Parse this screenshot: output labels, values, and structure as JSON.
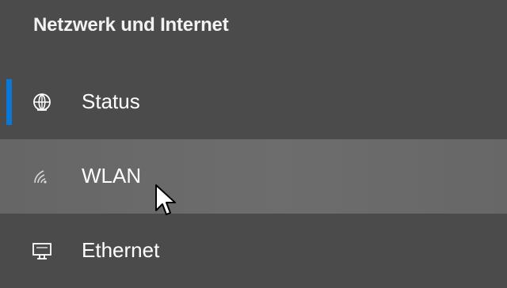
{
  "panel": {
    "title": "Netzwerk und Internet"
  },
  "nav": {
    "items": [
      {
        "id": "status",
        "label": "Status",
        "icon": "globe-icon",
        "selected": true
      },
      {
        "id": "wlan",
        "label": "WLAN",
        "icon": "wifi-icon",
        "hovered": true
      },
      {
        "id": "ethernet",
        "label": "Ethernet",
        "icon": "ethernet-icon"
      }
    ]
  },
  "colors": {
    "background": "#4b4b4b",
    "hover": "#6b6b6b",
    "accent": "#0a78d7",
    "text": "#ffffff"
  }
}
